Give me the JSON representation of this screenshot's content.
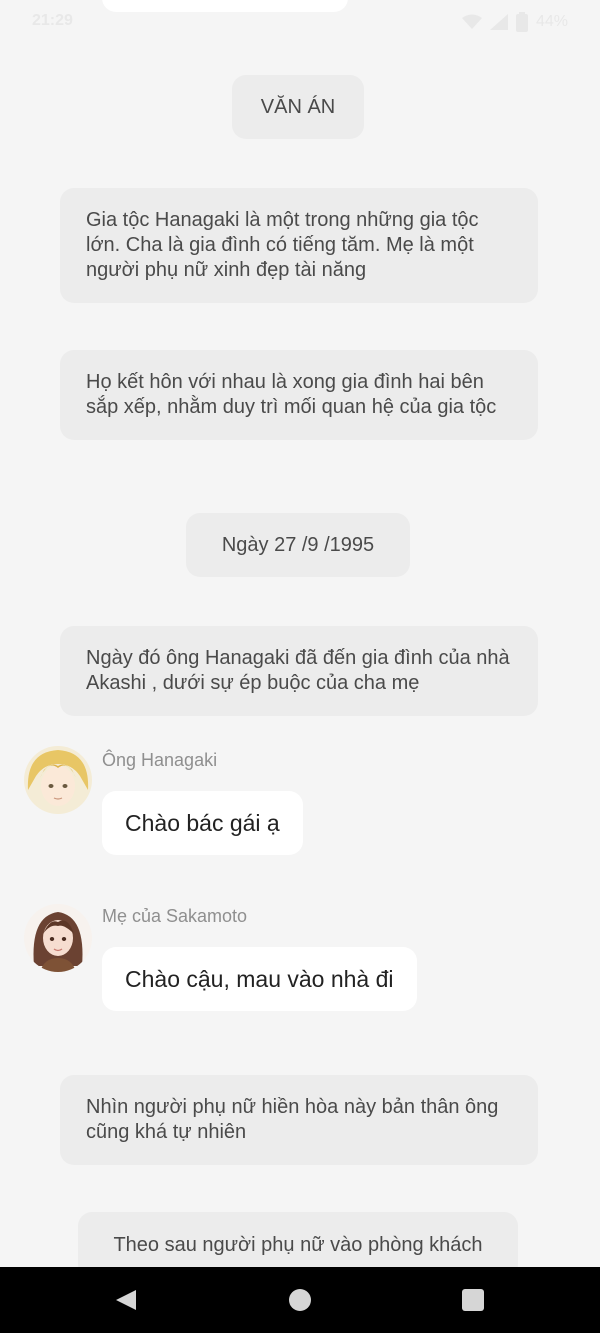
{
  "status": {
    "time": "21:29",
    "battery": "44%"
  },
  "story": {
    "title": "VĂN ÁN",
    "narr1": "Gia tộc Hanagaki là một trong những gia tộc lớn. Cha là gia đình có tiếng tăm. Mẹ là một người phụ nữ xinh đẹp tài năng",
    "narr2": "Họ kết hôn với nhau là xong gia đình hai bên sắp xếp, nhằm duy trì mối quan hệ của  gia tộc",
    "date": "Ngày 27 /9 /1995",
    "narr3": "Ngày đó  ông Hanagaki đã đến gia đình của nhà Akashi , dưới sự ép buộc của cha mẹ",
    "narr4": "Nhìn người phụ nữ hiền hòa này bản thân ông cũng khá tự nhiên",
    "narr5": "Theo sau người phụ nữ vào phòng khách"
  },
  "messages": [
    {
      "speaker": "Ông Hanagaki",
      "text": "Chào bác gái ạ"
    },
    {
      "speaker": "Mẹ của Sakamoto",
      "text": "Chào cậu, mau vào nhà đi"
    }
  ]
}
